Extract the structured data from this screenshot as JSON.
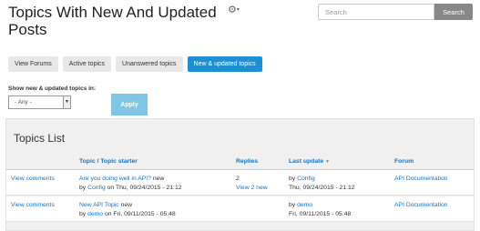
{
  "header": {
    "title": "Topics With New And Updated Posts",
    "gear_icon": "gear-icon"
  },
  "search": {
    "placeholder": "Search",
    "button_label": "Search"
  },
  "tabs": [
    {
      "label": "View Forums",
      "active": false
    },
    {
      "label": "Active topics",
      "active": false
    },
    {
      "label": "Unanswered topics",
      "active": false
    },
    {
      "label": "New & updated topics",
      "active": true
    }
  ],
  "filter": {
    "label": "Show new & updated topics in:",
    "selected": "- Any -",
    "apply_label": "Apply"
  },
  "topics": {
    "title": "Topics List",
    "columns": {
      "topic": "Topic / Topic starter",
      "replies": "Replies",
      "last_update": "Last update",
      "forum": "Forum"
    },
    "rows": [
      {
        "icon_text": "View comments",
        "topic_title": "Are you doing well in API?",
        "new_marker": "new",
        "by_prefix": "by",
        "starter": "Config",
        "started_on": "on Thu, 09/24/2015 - 21:12",
        "replies": "2",
        "replies_new": "View 2 new",
        "last_by_prefix": "by",
        "last_user": "Config",
        "last_date": "Thu, 09/24/2015 - 21:12",
        "forum": "API Documentation"
      },
      {
        "icon_text": "View comments",
        "topic_title": "New API Topic",
        "new_marker": "new",
        "by_prefix": "by",
        "starter": "demo",
        "started_on": "on Fri, 09/11/2015 - 05:48",
        "replies": "",
        "replies_new": "",
        "last_by_prefix": "by",
        "last_user": "demo",
        "last_date": "Fri, 09/11/2015 - 05:48",
        "forum": "API Documentation"
      }
    ]
  }
}
